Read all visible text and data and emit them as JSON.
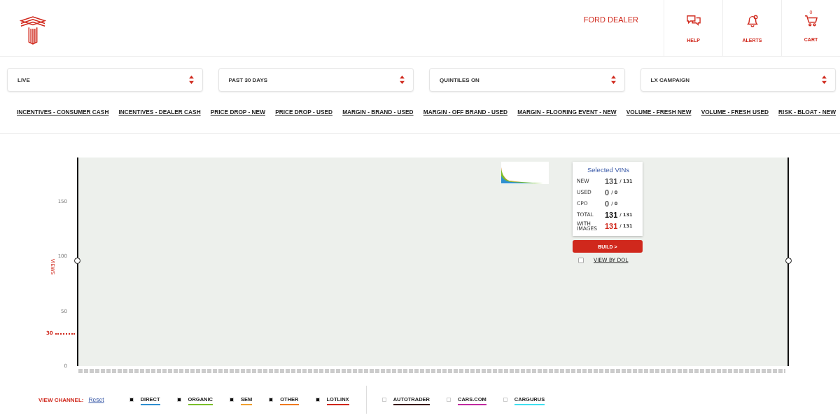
{
  "header": {
    "dealer": "FORD DEALER",
    "actions": [
      {
        "label": "HELP"
      },
      {
        "label": "ALERTS"
      },
      {
        "label": "CART",
        "badge": "0"
      }
    ]
  },
  "filters": [
    {
      "value": "LIVE"
    },
    {
      "value": "PAST 30 DAYS"
    },
    {
      "value": "QUINTILES ON"
    },
    {
      "value": "LX CAMPAIGN"
    }
  ],
  "campaigns": [
    "INCENTIVES - CONSUMER CASH",
    "INCENTIVES - DEALER CASH",
    "PRICE DROP - NEW",
    "PRICE DROP - USED",
    "MARGIN - BRAND - USED",
    "MARGIN - OFF BRAND - USED",
    "MARGIN - FLOORING EVENT - NEW",
    "VOLUME - FRESH NEW",
    "VOLUME - FRESH USED",
    "RISK - BLOAT - NEW"
  ],
  "chart": {
    "ylabel": "VIEWS",
    "yticks": [
      "150",
      "100",
      "50",
      "0"
    ],
    "threshold": "30"
  },
  "selected_vins": {
    "title": "Selected VINs",
    "rows": [
      {
        "label": "NEW",
        "value": "131",
        "total": "/ 131",
        "kind": "normal"
      },
      {
        "label": "USED",
        "value": "0",
        "total": "/ 0",
        "kind": "normal"
      },
      {
        "label": "CPO",
        "value": "0",
        "total": "/ 0",
        "kind": "normal"
      },
      {
        "label": "TOTAL",
        "value": "131",
        "total": "/ 131",
        "kind": "total"
      },
      {
        "label": "WITH IMAGES",
        "value": "131",
        "total": "/ 131",
        "kind": "images"
      }
    ],
    "build_button": "BUILD >",
    "view_by_dol": {
      "label": "VIEW BY DOL",
      "checked": false
    }
  },
  "channels": {
    "label": "VIEW CHANNEL:",
    "reset": "Reset",
    "groups": [
      [
        {
          "name": "DIRECT",
          "checked": true,
          "color": "#2f8fd0"
        },
        {
          "name": "ORGANIC",
          "checked": true,
          "color": "#7bbf2a"
        },
        {
          "name": "SEM",
          "checked": true,
          "color": "#f0a030"
        },
        {
          "name": "OTHER",
          "checked": true,
          "color": "#f07a20"
        },
        {
          "name": "LOTLINX",
          "checked": true,
          "color": "#d0281c"
        }
      ],
      [
        {
          "name": "AUTOTRADER",
          "checked": false,
          "color": "#3a1010"
        },
        {
          "name": "CARS.COM",
          "checked": false,
          "color": "#c02aa0"
        },
        {
          "name": "CARGURUS",
          "checked": false,
          "color": "#40e0f0"
        }
      ]
    ]
  }
}
